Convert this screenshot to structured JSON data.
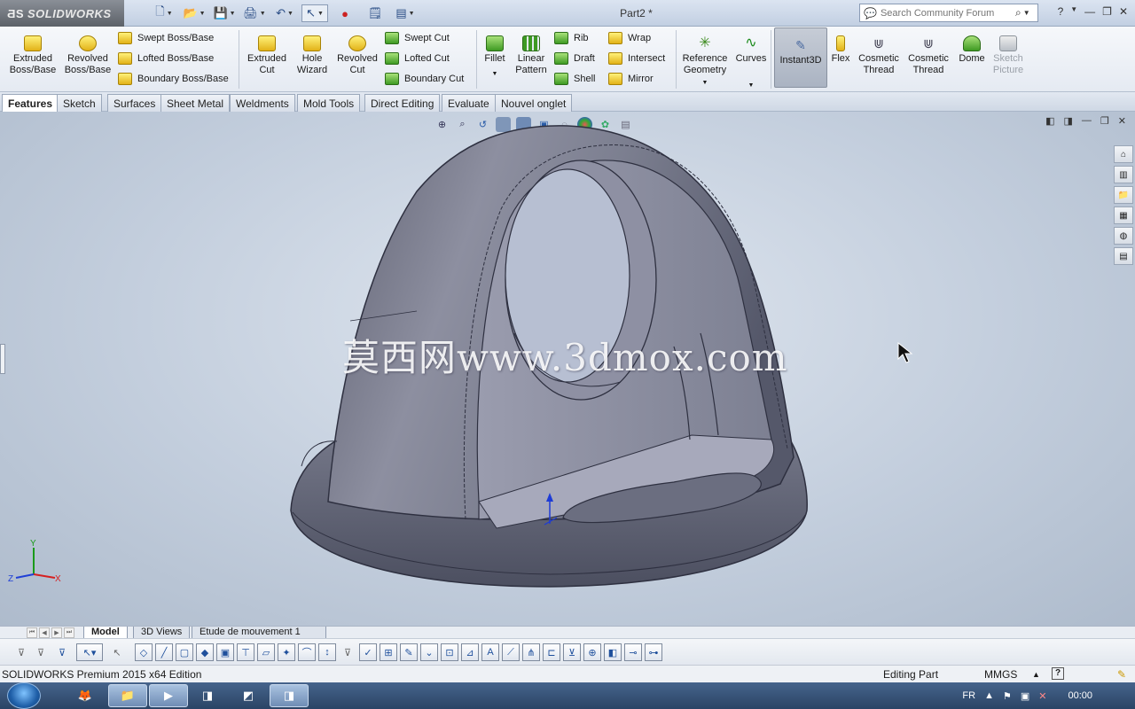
{
  "app": {
    "logo_text": "SOLIDWORKS",
    "doc_title": "Part2 *"
  },
  "search": {
    "placeholder": "Search Community Forum"
  },
  "ribbon": {
    "extruded_boss": "Extruded Boss/Base",
    "revolved_boss": "Revolved Boss/Base",
    "swept_boss": "Swept Boss/Base",
    "lofted_boss": "Lofted Boss/Base",
    "boundary_boss": "Boundary Boss/Base",
    "extruded_cut": "Extruded Cut",
    "hole_wizard": "Hole Wizard",
    "revolved_cut": "Revolved Cut",
    "swept_cut": "Swept Cut",
    "lofted_cut": "Lofted Cut",
    "boundary_cut": "Boundary Cut",
    "fillet": "Fillet",
    "linear_pattern": "Linear Pattern",
    "rib": "Rib",
    "draft": "Draft",
    "shell": "Shell",
    "wrap": "Wrap",
    "intersect": "Intersect",
    "mirror": "Mirror",
    "reference_geometry": "Reference Geometry",
    "curves": "Curves",
    "instant3d": "Instant3D",
    "flex": "Flex",
    "cosmetic_thread_1": "Cosmetic Thread",
    "cosmetic_thread_2": "Cosmetic Thread",
    "dome": "Dome",
    "sketch_picture": "Sketch Picture"
  },
  "command_tabs": [
    "Features",
    "Sketch",
    "Surfaces",
    "Sheet Metal",
    "Weldments",
    "Mold Tools",
    "Direct Editing",
    "Evaluate",
    "Nouvel onglet"
  ],
  "watermark": "莫西网www.3dmox.com",
  "triad": {
    "x": "X",
    "y": "Y",
    "z": "Z"
  },
  "bottom_tabs": [
    "Model",
    "3D Views",
    "Etude de mouvement 1"
  ],
  "status": {
    "edition": "SOLIDWORKS Premium 2015 x64 Edition",
    "mode": "Editing Part",
    "units": "MMGS",
    "help": "?"
  },
  "taskbar": {
    "lang": "FR",
    "clock": "00:00"
  }
}
